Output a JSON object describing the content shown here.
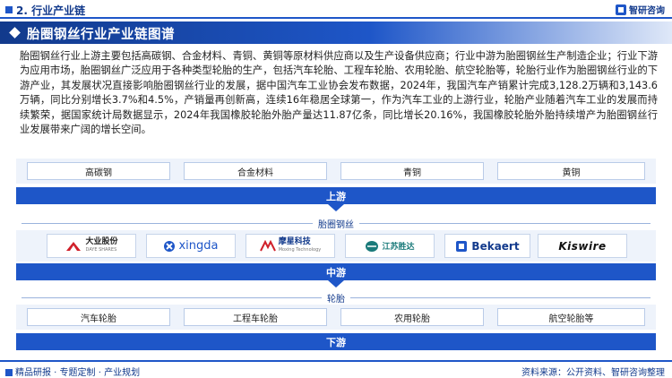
{
  "header": {
    "section": "2. 行业产业链",
    "brand": "智研咨询"
  },
  "title": "胎圈钢丝行业产业链图谱",
  "paragraph": "胎圈钢丝行业上游主要包括高碳钢、合金材料、青铜、黄铜等原材料供应商以及生产设备供应商；行业中游为胎圈钢丝生产制造企业；行业下游为应用市场，胎圈钢丝广泛应用于各种类型轮胎的生产，包括汽车轮胎、工程车轮胎、农用轮胎、航空轮胎等，轮胎行业作为胎圈钢丝行业的下游产业，其发展状况直接影响胎圈钢丝行业的发展，据中国汽车工业协会发布数据，2024年，我国汽车产销累计完成3,128.2万辆和3,143.6万辆，同比分别增长3.7%和4.5%，产销量再创新高，连续16年稳居全球第一，作为汽车工业的上游行业，轮胎产业随着汽车工业的发展而持续繁荣，据国家统计局数据显示，2024年我国橡胶轮胎外胎产量达11.87亿条，同比增长20.16%，我国橡胶轮胎外胎持续增产为胎圈钢丝行业发展带来广阔的增长空间。",
  "upstream": {
    "items": [
      "高碳钢",
      "合金材料",
      "青铜",
      "黄铜"
    ],
    "label": "上游"
  },
  "midstream": {
    "caption": "胎圈钢丝",
    "companies": [
      {
        "name": "大业股份",
        "sub": "DAYE SHARES",
        "color": "#d0202a"
      },
      {
        "name": "xingda",
        "color": "#1e56c8"
      },
      {
        "name": "摩星科技",
        "sub": "Moxing Technology",
        "color": "#123a8c"
      },
      {
        "name": "江苏胜达",
        "color": "#1a7a7a"
      },
      {
        "name": "Bekaert",
        "color": "#1e56c8"
      },
      {
        "name": "Kiswire",
        "color": "#111111"
      }
    ],
    "label": "中游"
  },
  "downstream": {
    "caption": "轮胎",
    "items": [
      "汽车轮胎",
      "工程车轮胎",
      "农用轮胎",
      "航空轮胎等"
    ],
    "label": "下游"
  },
  "footer": {
    "left": "精品研报 · 专题定制 · 产业规划",
    "right": "资料来源：公开资料、智研咨询整理"
  },
  "colors": {
    "primary": "#1e56c8",
    "dark": "#123a8c",
    "panel": "#eef3fb"
  }
}
